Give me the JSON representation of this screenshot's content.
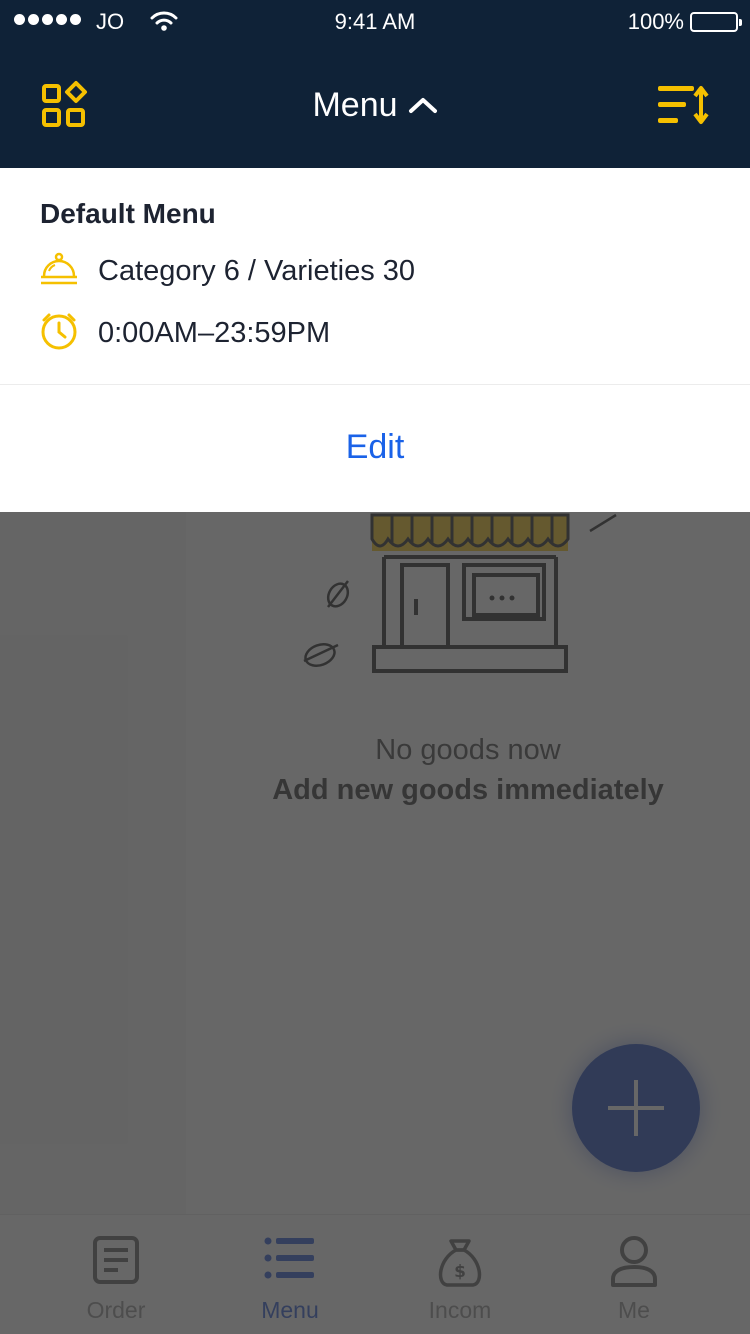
{
  "status_bar": {
    "carrier": "JO",
    "time": "9:41 AM",
    "battery": "100%"
  },
  "nav": {
    "title": "Menu",
    "left_icon": "grid-apps-icon",
    "right_icon": "sort-list-icon",
    "title_icon": "chevron-up-icon"
  },
  "dropdown": {
    "title": "Default Menu",
    "category_line": "Category 6 / Varieties 30",
    "hours_line": "0:00AM–23:59PM",
    "edit_label": "Edit",
    "category_icon": "service-bell-icon",
    "hours_icon": "clock-icon"
  },
  "empty_state": {
    "line1": "No goods now",
    "line2": "Add new goods immediately",
    "illustration": "shop-storefront-icon"
  },
  "fab": {
    "icon": "plus-icon"
  },
  "tabbar": {
    "items": [
      {
        "label": "Order",
        "icon": "order-document-icon"
      },
      {
        "label": "Menu",
        "icon": "menu-list-icon",
        "active": true
      },
      {
        "label": "Incom",
        "icon": "money-bag-icon"
      },
      {
        "label": "Me",
        "icon": "person-icon"
      }
    ]
  },
  "colors": {
    "nav_bg": "#0f2237",
    "accent_yellow": "#f5c000",
    "link_blue": "#1a62e8",
    "fab_blue": "#0a36b8",
    "active_tab": "#1848d0"
  }
}
